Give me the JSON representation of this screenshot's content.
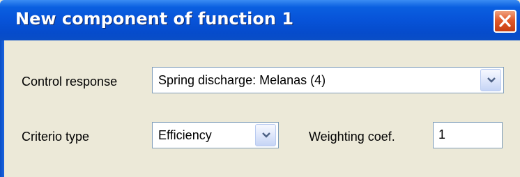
{
  "window": {
    "title": "New component of function 1",
    "close_icon": "close-x-icon",
    "colors": {
      "titlebar": "#0753d8",
      "dialog_bg": "#ece9d8",
      "close": "#e25a2b"
    }
  },
  "form": {
    "control_response": {
      "label": "Control response",
      "value": "Spring discharge: Melanas (4)",
      "dropdown_icon": "chevron-down-icon"
    },
    "criterio_type": {
      "label": "Criterio type",
      "value": "Efficiency",
      "dropdown_icon": "chevron-down-icon"
    },
    "weighting_coef": {
      "label": "Weighting coef.",
      "value": "1"
    }
  }
}
